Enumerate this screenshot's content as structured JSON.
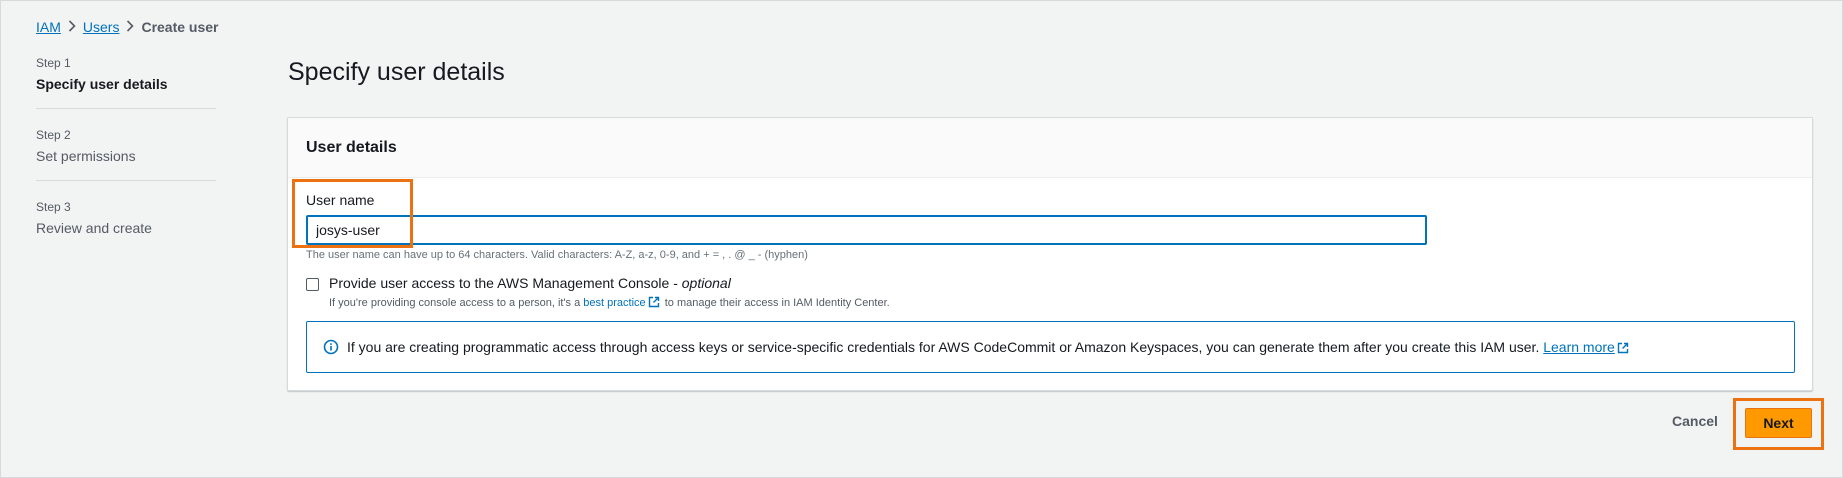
{
  "breadcrumb": {
    "items": [
      "IAM",
      "Users"
    ],
    "current": "Create user"
  },
  "steps": [
    {
      "num": "Step 1",
      "label": "Specify user details"
    },
    {
      "num": "Step 2",
      "label": "Set permissions"
    },
    {
      "num": "Step 3",
      "label": "Review and create"
    }
  ],
  "page": {
    "title": "Specify user details"
  },
  "panel": {
    "header": "User details",
    "username_label": "User name",
    "username_value": "josys-user",
    "username_hint": "The user name can have up to 64 characters. Valid characters: A-Z, a-z, 0-9, and + = , . @ _ - (hyphen)",
    "console_label": "Provide user access to the AWS Management Console - ",
    "console_optional": "optional",
    "console_desc_pre": "If you're providing console access to a person, it's a ",
    "console_desc_link": "best practice",
    "console_desc_post": " to manage their access in IAM Identity Center.",
    "info_text": "If you are creating programmatic access through access keys or service-specific credentials for AWS CodeCommit or Amazon Keyspaces, you can generate them after you create this IAM user. ",
    "info_link": "Learn more"
  },
  "actions": {
    "cancel": "Cancel",
    "next": "Next"
  },
  "colors": {
    "link": "#0073bb",
    "primary": "#ff9900",
    "highlight": "#ec7211"
  }
}
